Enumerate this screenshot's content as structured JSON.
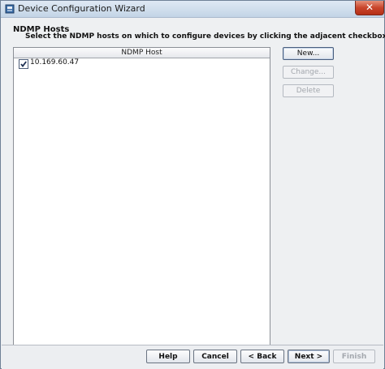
{
  "window": {
    "title": "Device Configuration Wizard",
    "close_glyph": "✕"
  },
  "header": {
    "title": "NDMP Hosts",
    "description": "Select the NDMP hosts on which to configure devices by clicking the adjacent checkbox."
  },
  "table": {
    "column_header": "NDMP Host",
    "rows": [
      {
        "checked": true,
        "host": "10.169.60.47"
      }
    ],
    "scroll_thumb_icon": "grip-icon"
  },
  "side_buttons": {
    "new": {
      "label": "New...",
      "enabled": true
    },
    "change": {
      "label": "Change...",
      "enabled": false
    },
    "delete": {
      "label": "Delete",
      "enabled": false
    }
  },
  "footer": {
    "help": {
      "label": "Help",
      "enabled": true
    },
    "cancel": {
      "label": "Cancel",
      "enabled": true
    },
    "back": {
      "label": "< Back",
      "enabled": true
    },
    "next": {
      "label": "Next >",
      "enabled": true
    },
    "finish": {
      "label": "Finish",
      "enabled": false
    }
  },
  "colors": {
    "accent_border": "#4a5f7f",
    "disabled_text": "#a3a7ad",
    "close_red": "#c8452b"
  }
}
